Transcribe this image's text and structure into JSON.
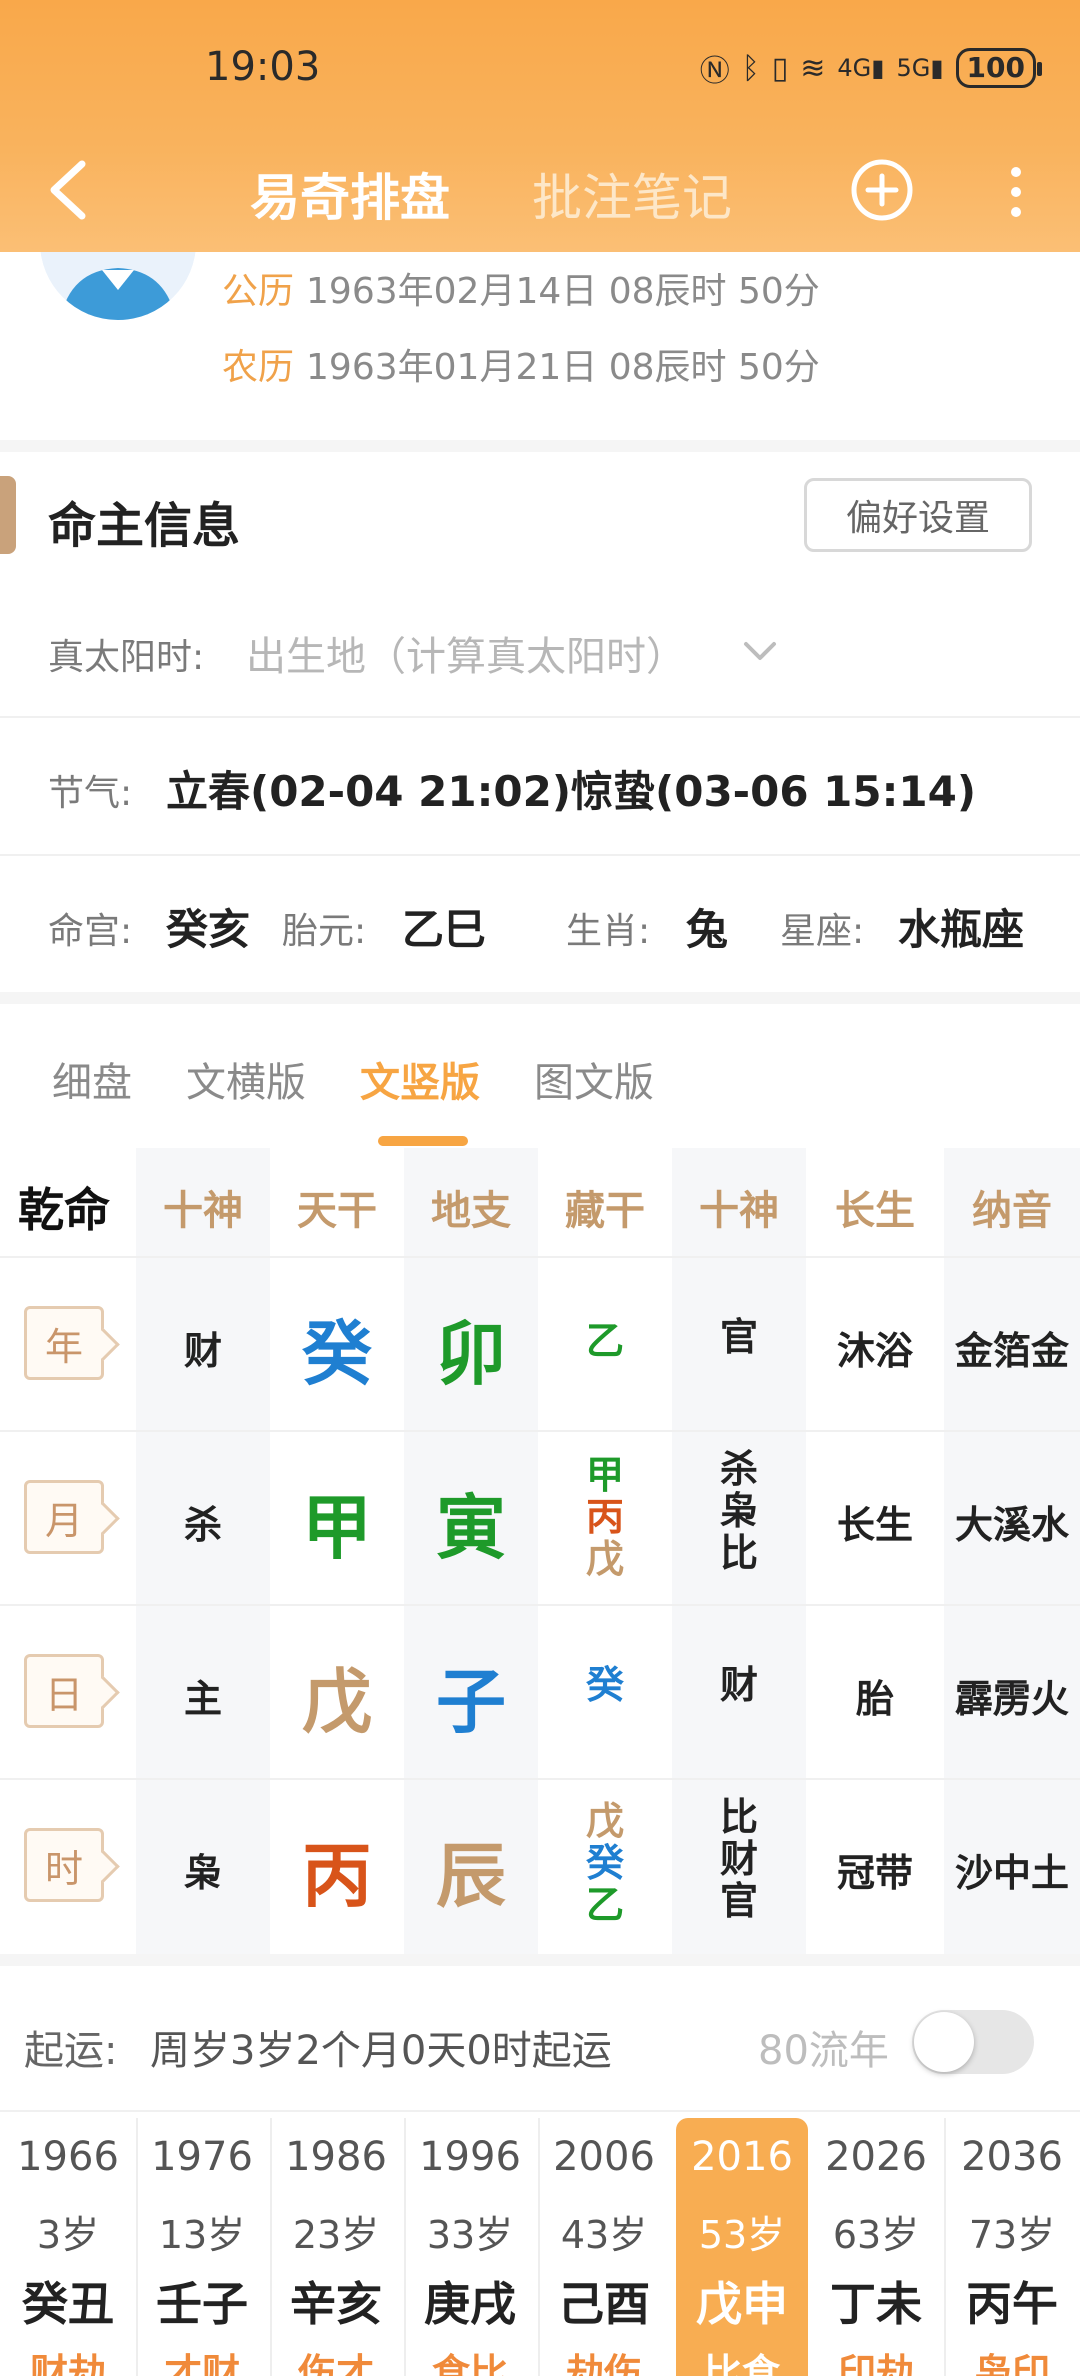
{
  "status": {
    "time": "19:03",
    "battery": "100"
  },
  "nav": {
    "title": "易奇排盘",
    "title2": "批注笔记"
  },
  "birth": {
    "solar_label": "公历",
    "solar": "1963年02月14日 08辰时 50分",
    "lunar_label": "农历",
    "lunar": "1963年01月21日 08辰时 50分"
  },
  "section": {
    "title": "命主信息",
    "pref_button": "偏好设置"
  },
  "info": {
    "true_solar_label": "真太阳时:",
    "true_solar_placeholder": "出生地（计算真太阳时）",
    "jieqi_label": "节气:",
    "jieqi_value": "立春(02-04 21:02)惊蛰(03-06 15:14)",
    "minggong_label": "命宫:",
    "minggong": "癸亥",
    "taiyuan_label": "胎元:",
    "taiyuan": "乙巳",
    "shengxiao_label": "生肖:",
    "shengxiao": "兔",
    "xingzuo_label": "星座:",
    "xingzuo": "水瓶座"
  },
  "tabs": [
    "细盘",
    "文横版",
    "文竖版",
    "图文版"
  ],
  "table": {
    "corner": "乾命",
    "headers": [
      "十神",
      "天干",
      "地支",
      "藏干",
      "十神",
      "长生",
      "纳音"
    ],
    "rows": [
      {
        "pillar": "年",
        "shishen": "财",
        "tiangan": "癸",
        "dizhi": "卯",
        "canggan": [
          "乙"
        ],
        "shishen2": [
          "官"
        ],
        "changsheng": "沐浴",
        "nayin": "金箔金"
      },
      {
        "pillar": "月",
        "shishen": "杀",
        "tiangan": "甲",
        "dizhi": "寅",
        "canggan": [
          "甲",
          "丙",
          "戊"
        ],
        "shishen2": [
          "杀",
          "枭",
          "比"
        ],
        "changsheng": "长生",
        "nayin": "大溪水"
      },
      {
        "pillar": "日",
        "shishen": "主",
        "tiangan": "戊",
        "dizhi": "子",
        "canggan": [
          "癸"
        ],
        "shishen2": [
          "财"
        ],
        "changsheng": "胎",
        "nayin": "霹雳火"
      },
      {
        "pillar": "时",
        "shishen": "枭",
        "tiangan": "丙",
        "dizhi": "辰",
        "canggan": [
          "戊",
          "癸",
          "乙"
        ],
        "shishen2": [
          "比",
          "财",
          "官"
        ],
        "changsheng": "冠带",
        "nayin": "沙中土"
      }
    ]
  },
  "luck": {
    "label": "起运:",
    "text": "周岁3岁2个月0天0时起运",
    "liunian_label": "80流年",
    "liunian_on": false
  },
  "dayun": [
    {
      "year": "1966",
      "age": "3岁",
      "gz": "癸丑",
      "ss": "财劫"
    },
    {
      "year": "1976",
      "age": "13岁",
      "gz": "壬子",
      "ss": "才财"
    },
    {
      "year": "1986",
      "age": "23岁",
      "gz": "辛亥",
      "ss": "伤才"
    },
    {
      "year": "1996",
      "age": "33岁",
      "gz": "庚戌",
      "ss": "食比"
    },
    {
      "year": "2006",
      "age": "43岁",
      "gz": "己酉",
      "ss": "劫伤"
    },
    {
      "year": "2016",
      "age": "53岁",
      "gz": "戊申",
      "ss": "比食"
    },
    {
      "year": "2026",
      "age": "63岁",
      "gz": "丁未",
      "ss": "印劫"
    },
    {
      "year": "2036",
      "age": "73岁",
      "gz": "丙午",
      "ss": "枭印"
    }
  ],
  "colors": {
    "accent": "#f7a543",
    "brown": "#c49a6c",
    "blue": "#1f7fd1",
    "green": "#1e9a2a",
    "orange": "#d8541a"
  }
}
